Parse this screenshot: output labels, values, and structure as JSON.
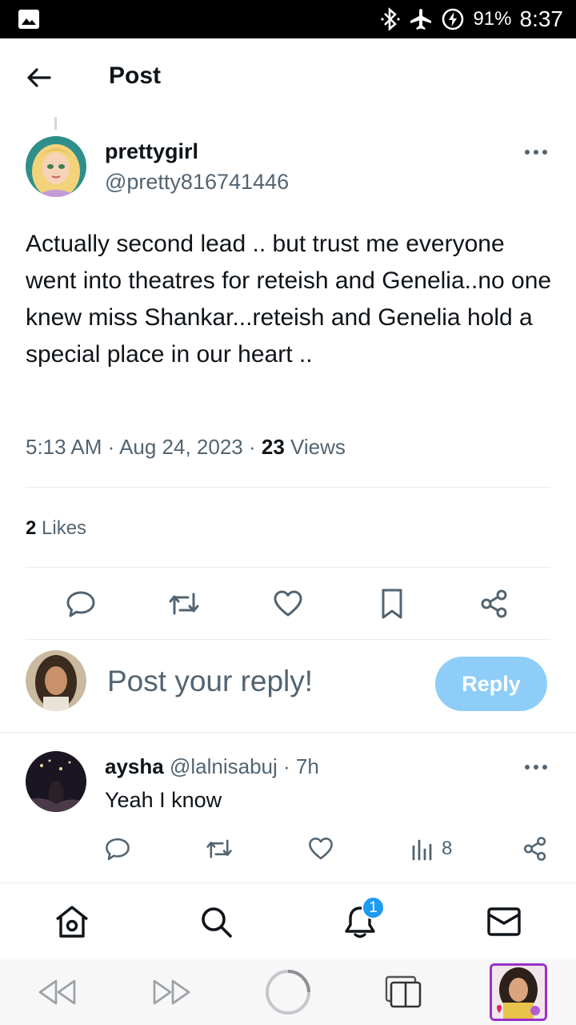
{
  "status_bar": {
    "battery_percent": "91%",
    "time": "8:37",
    "icons": [
      "gallery-icon",
      "bluetooth-icon",
      "airplane-mode-icon",
      "battery-saver-icon"
    ]
  },
  "header": {
    "title": "Post",
    "back_icon": "back-arrow-icon"
  },
  "post": {
    "author_name": "prettygirl",
    "author_handle": "@pretty816741446",
    "text": "Actually second lead .. but trust me everyone went into theatres for reteish and Genelia..no one knew miss Shankar...reteish and Genelia hold a special place in our heart ..",
    "timestamp": "5:13 AM · Aug 24, 2023 · ",
    "views_count": "23",
    "views_label": " Views",
    "likes_count": "2",
    "likes_label": " Likes",
    "actions": [
      "reply-icon",
      "repost-icon",
      "like-icon",
      "bookmark-icon",
      "share-icon"
    ]
  },
  "composer": {
    "placeholder": "Post your reply!",
    "reply_button": "Reply",
    "reply_button_color": "#8ecdf8"
  },
  "replies": [
    {
      "name": "aysha",
      "handle": "@lalnisabuj",
      "time": " · 7h",
      "text": "Yeah I know",
      "views": "8"
    }
  ],
  "bottom_nav": {
    "items": [
      "home-icon",
      "search-icon",
      "notifications-icon",
      "messages-icon"
    ],
    "notification_badge": "1",
    "accent": "#1d9bf0"
  },
  "system_bar": {
    "items": [
      "rewind-icon",
      "fast-forward-icon",
      "loading-circle-icon",
      "tabs-icon",
      "profile-thumbnail"
    ]
  }
}
